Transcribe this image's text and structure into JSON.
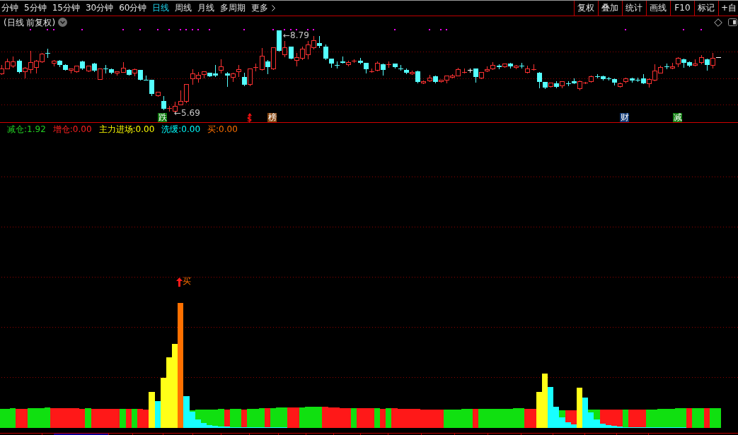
{
  "toolbar": {
    "periods": [
      {
        "label": "分钟",
        "selected": false
      },
      {
        "label": "5分钟",
        "selected": false
      },
      {
        "label": "15分钟",
        "selected": false
      },
      {
        "label": "30分钟",
        "selected": false
      },
      {
        "label": "60分钟",
        "selected": false
      },
      {
        "label": "日线",
        "selected": true
      },
      {
        "label": "周线",
        "selected": false
      },
      {
        "label": "月线",
        "selected": false
      },
      {
        "label": "多周期",
        "selected": false
      }
    ],
    "more_menu": {
      "label": "更多"
    },
    "tools": [
      "复权",
      "叠加",
      "统计",
      "画线",
      "F10",
      "标记",
      "+自"
    ]
  },
  "price_chart": {
    "title": "(日线 前复权)",
    "high_label": "←8.79",
    "low_label": "←5.69",
    "markers": [
      {
        "kind": "badge",
        "text": "跌",
        "color": "#0c780c"
      },
      {
        "kind": "symbol",
        "text": "$",
        "color": "#ff1010"
      },
      {
        "kind": "badge",
        "text": "榜",
        "color": "#8a4a14"
      },
      {
        "kind": "badge",
        "text": "财",
        "color": "#0c3470"
      },
      {
        "kind": "badge",
        "text": "减",
        "color": "#138013"
      }
    ]
  },
  "indicator": {
    "legend": [
      {
        "label": "减仓:",
        "value": "1.92",
        "color": "#22cc22"
      },
      {
        "label": "增仓:",
        "value": "0.00",
        "color": "#ff2020"
      },
      {
        "label": "主力进场:",
        "value": "0.00",
        "color": "#ffff00"
      },
      {
        "label": "洗缓:",
        "value": "0.00",
        "color": "#00ffff"
      },
      {
        "label": "买:",
        "value": "0.00",
        "color": "#ff7000"
      }
    ],
    "signal": {
      "text": "买"
    }
  }
}
